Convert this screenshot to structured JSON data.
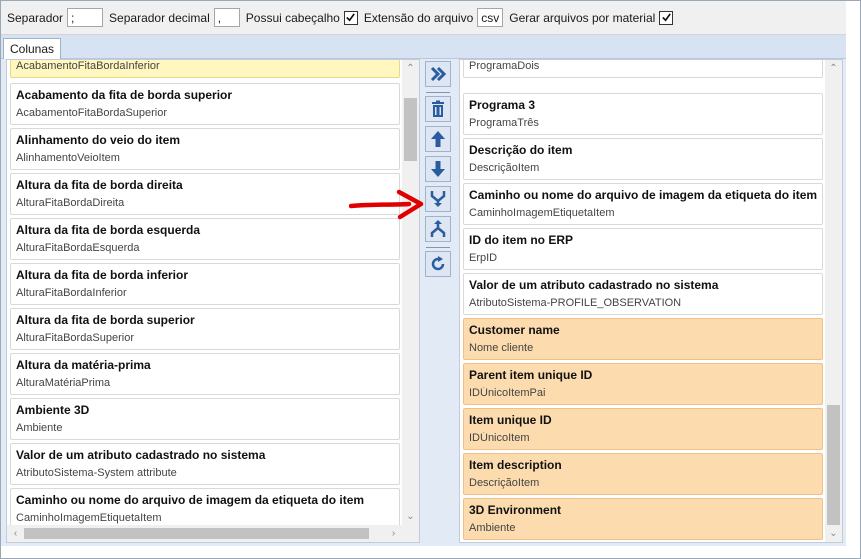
{
  "toolbar": {
    "separator_label": "Separador",
    "separator_value": ";",
    "decimal_label": "Separador decimal",
    "decimal_value": ",",
    "header_label": "Possui cabeçalho",
    "header_checked": true,
    "extension_label": "Extensão do arquivo",
    "extension_value": "csv",
    "per_material_label": "Gerar arquivos por material",
    "per_material_checked": true
  },
  "tabs": [
    {
      "label": "Colunas",
      "active": true
    }
  ],
  "left_list": {
    "partial_top_value": "AcabamentoFitaBordaInferior",
    "items": [
      {
        "title": "Acabamento da fita de borda superior",
        "value": "AcabamentoFitaBordaSuperior"
      },
      {
        "title": "Alinhamento do veio do item",
        "value": "AlinhamentoVeioItem"
      },
      {
        "title": "Altura da fita de borda direita",
        "value": "AlturaFitaBordaDireita"
      },
      {
        "title": "Altura da fita de borda esquerda",
        "value": "AlturaFitaBordaEsquerda"
      },
      {
        "title": "Altura da fita de borda inferior",
        "value": "AlturaFitaBordaInferior"
      },
      {
        "title": "Altura da fita de borda superior",
        "value": "AlturaFitaBordaSuperior"
      },
      {
        "title": "Altura da matéria-prima",
        "value": "AlturaMatériaPrima"
      },
      {
        "title": "Ambiente 3D",
        "value": "Ambiente"
      },
      {
        "title": "Valor de um atributo cadastrado no sistema",
        "value": "AtributoSistema-System attribute"
      },
      {
        "title": "Caminho ou nome do arquivo de imagem da etiqueta do item",
        "value": "CaminhoImagemEtiquetaItem"
      }
    ]
  },
  "buttons": [
    {
      "name": "add-all-button",
      "icon": "double-chevron-right-icon"
    },
    {
      "name": "delete-button",
      "icon": "trash-icon"
    },
    {
      "name": "move-up-button",
      "icon": "arrow-up-icon"
    },
    {
      "name": "move-down-button",
      "icon": "arrow-down-icon"
    },
    {
      "name": "merge-button",
      "icon": "merge-icon"
    },
    {
      "name": "split-button",
      "icon": "split-icon"
    },
    {
      "name": "refresh-button",
      "icon": "refresh-icon"
    }
  ],
  "right_list": {
    "partial_top_value": "ProgramaDois",
    "items": [
      {
        "title": "Programa 3",
        "value": "ProgramaTrês",
        "highlight": "none"
      },
      {
        "title": "Descrição do item",
        "value": "DescriçãoItem",
        "highlight": "none"
      },
      {
        "title": "Caminho ou nome do arquivo de imagem da etiqueta do item",
        "value": "CaminhoImagemEtiquetaItem",
        "highlight": "none"
      },
      {
        "title": "ID do item no ERP",
        "value": "ErpID",
        "highlight": "none"
      },
      {
        "title": "Valor de um atributo cadastrado no sistema",
        "value": "AtributoSistema-PROFILE_OBSERVATION",
        "highlight": "none"
      },
      {
        "title": "Customer name",
        "value": "Nome cliente",
        "highlight": "orange"
      },
      {
        "title": "Parent item unique ID",
        "value": "IDÚnicoItemPai",
        "highlight": "orange"
      },
      {
        "title": "Item unique ID",
        "value": "IDÚnicoItem",
        "highlight": "orange"
      },
      {
        "title": "Item description",
        "value": "DescriçãoItem",
        "highlight": "orange"
      },
      {
        "title": "3D Environment",
        "value": "Ambiente",
        "highlight": "orange"
      }
    ]
  },
  "colors": {
    "highlight_orange": "#fcdcae",
    "highlight_yellow": "#fff7bf",
    "annotation_red": "#e00000",
    "tab_strip": "#d7e3f3"
  }
}
